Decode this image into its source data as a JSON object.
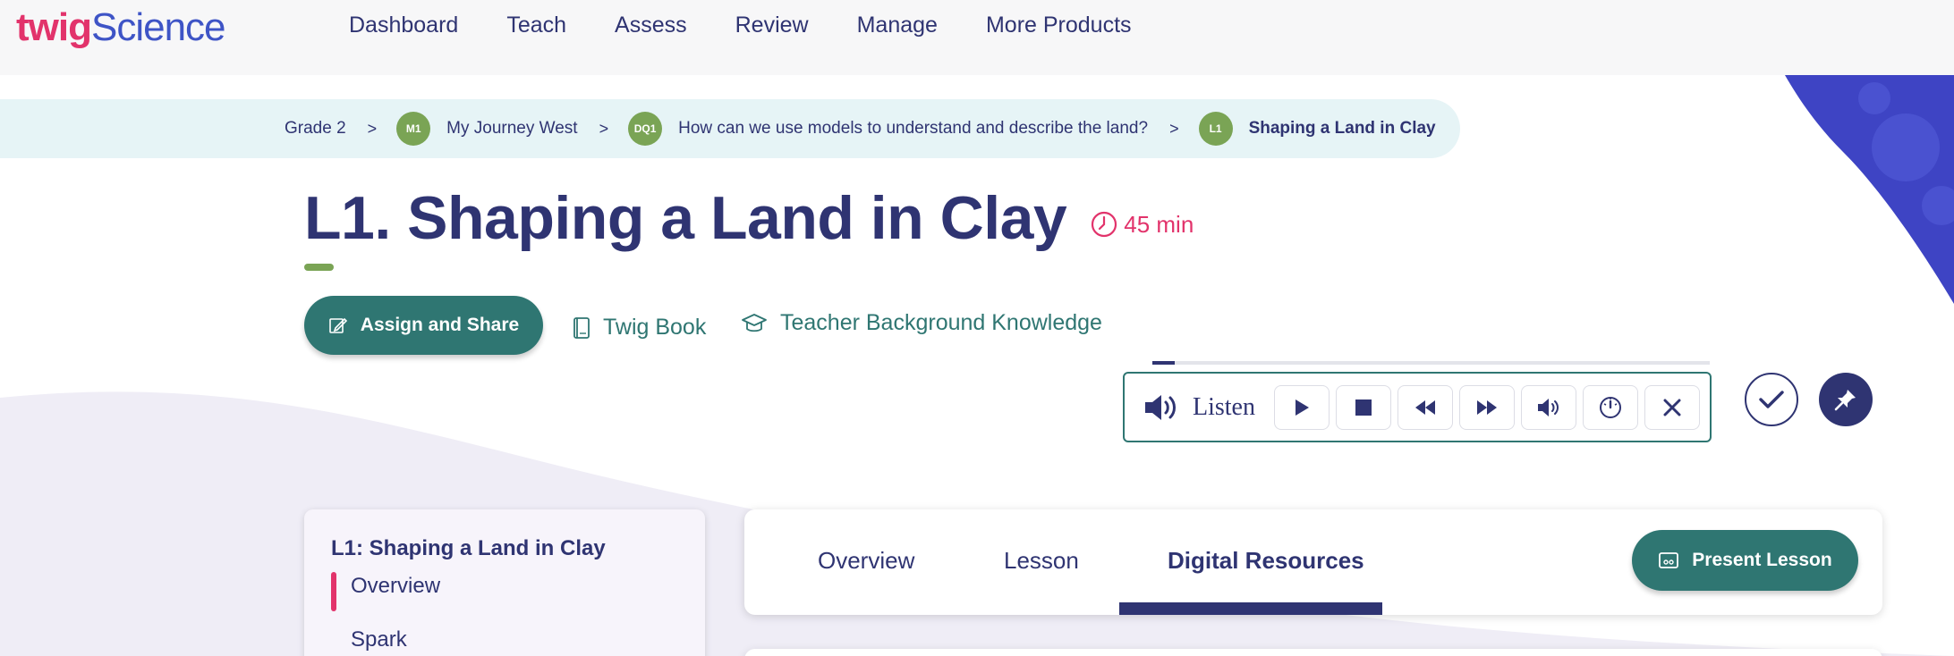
{
  "brand": {
    "logo_left": "twig",
    "logo_right": "Science",
    "primary_color": "#2f3472",
    "accent_color": "#2f7672",
    "pink": "#e2336b",
    "green": "#7aa455"
  },
  "nav": {
    "items": [
      "Dashboard",
      "Teach",
      "Assess",
      "Review",
      "Manage",
      "More Products"
    ]
  },
  "breadcrumb": {
    "grade": "Grade 2",
    "separator": ">",
    "module_badge": "M1",
    "module": "My Journey West",
    "question_badge": "DQ1",
    "question": "How can we use models to understand and describe the land?",
    "lesson_badge": "L1",
    "lesson": "Shaping a Land in Clay"
  },
  "page": {
    "title": "L1. Shaping a Land in Clay",
    "duration": "45 min"
  },
  "actions": {
    "assign": "Assign and Share",
    "twig_book": "Twig Book",
    "teacher_bg": "Teacher Background Knowledge"
  },
  "listen": {
    "label": "Listen",
    "progress": 0.04,
    "icons": [
      "speaker-icon",
      "play-icon",
      "stop-icon",
      "rewind-icon",
      "fast-forward-icon",
      "volume-icon",
      "speed-icon",
      "close-icon"
    ]
  },
  "sidebar": {
    "title": "L1: Shaping a Land in Clay",
    "items": [
      "Overview",
      "Spark"
    ]
  },
  "tabs": {
    "items": [
      "Overview",
      "Lesson",
      "Digital Resources"
    ],
    "active": "Digital Resources"
  },
  "present": {
    "label": "Present Lesson"
  }
}
